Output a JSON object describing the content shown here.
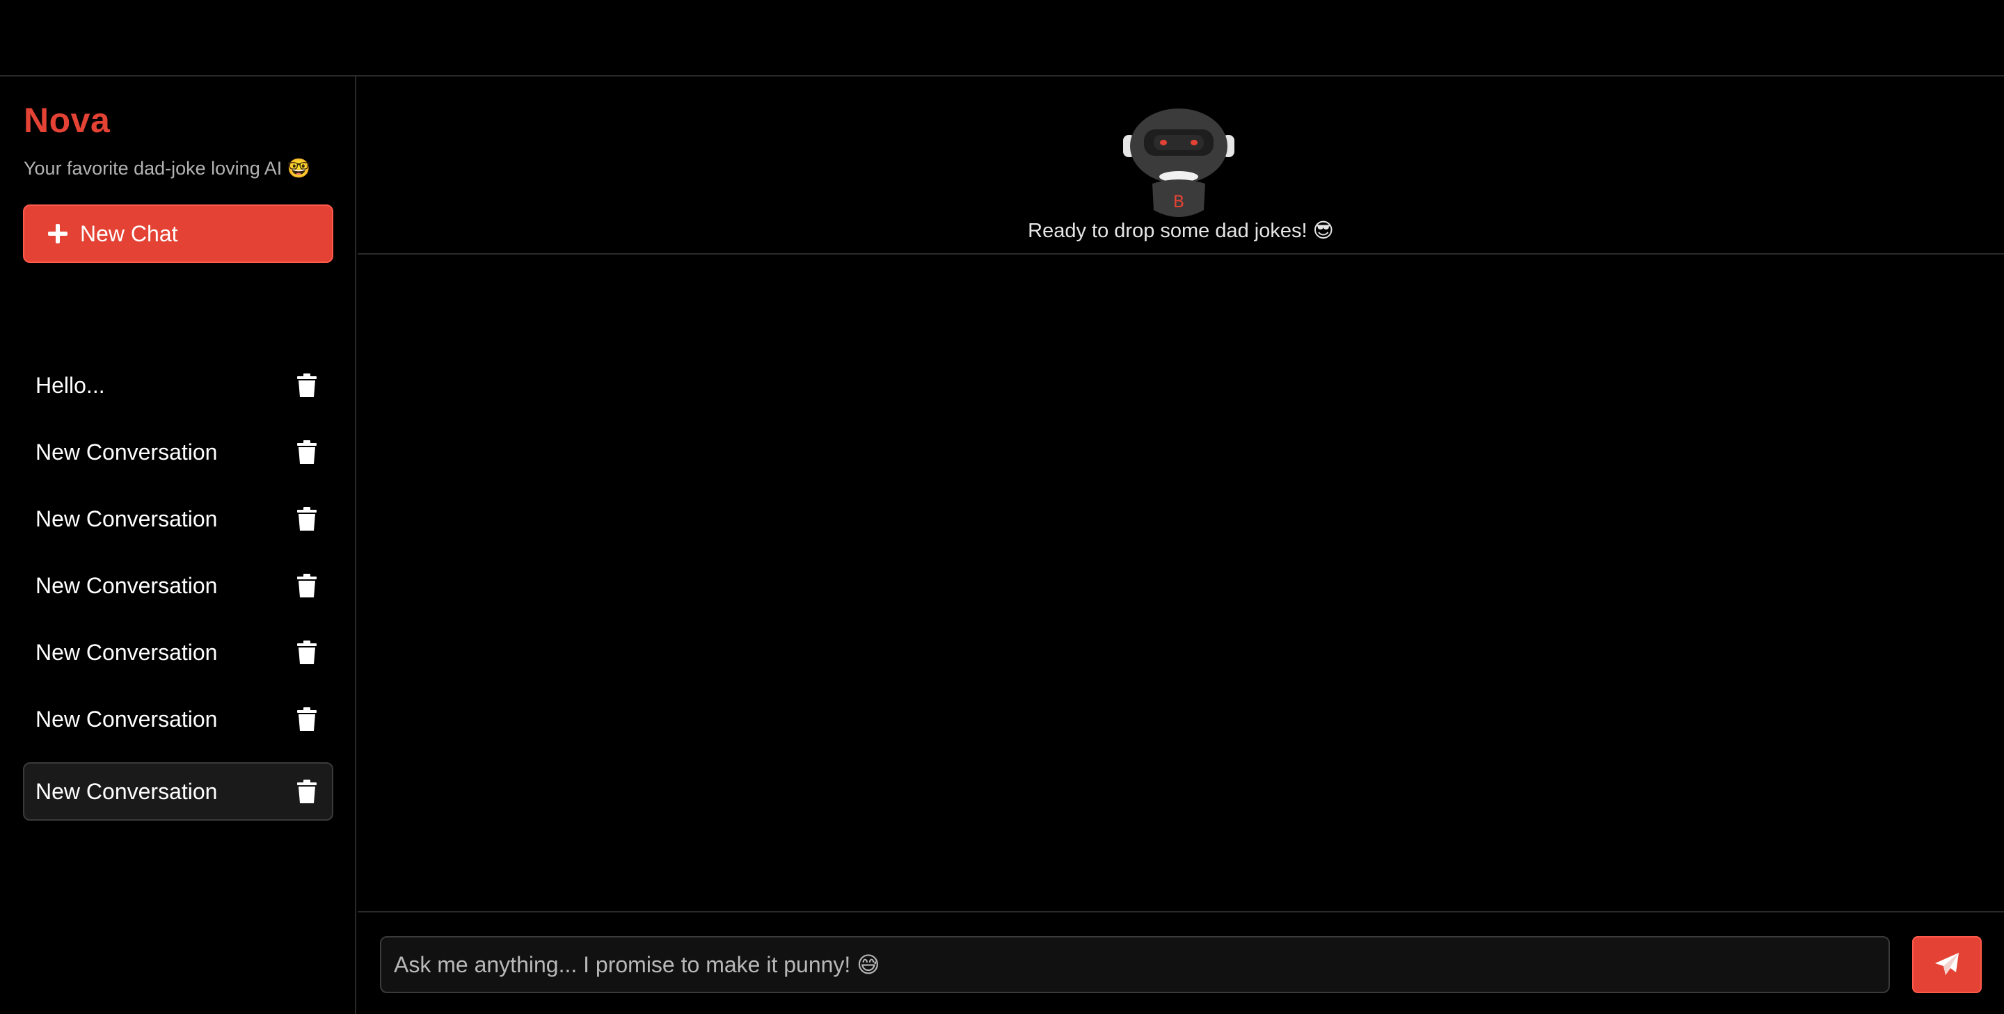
{
  "app": {
    "name": "Nova",
    "tagline": "Your favorite dad-joke loving AI 🤓",
    "accent_color": "#e34234"
  },
  "sidebar": {
    "new_chat_label": "New Chat",
    "new_chat_icon": "plus-icon",
    "conversations": [
      {
        "title": "Hello...",
        "active": false
      },
      {
        "title": "New Conversation",
        "active": false
      },
      {
        "title": "New Conversation",
        "active": false
      },
      {
        "title": "New Conversation",
        "active": false
      },
      {
        "title": "New Conversation",
        "active": false
      },
      {
        "title": "New Conversation",
        "active": false
      },
      {
        "title": "New Conversation",
        "active": true
      }
    ],
    "delete_icon": "trash-icon"
  },
  "hero": {
    "mascot_icon": "robot-icon",
    "status_text": "Ready to drop some dad jokes! 😎"
  },
  "composer": {
    "placeholder": "Ask me anything... I promise to make it punny! 😅",
    "value": "",
    "send_icon": "paper-plane-icon"
  }
}
